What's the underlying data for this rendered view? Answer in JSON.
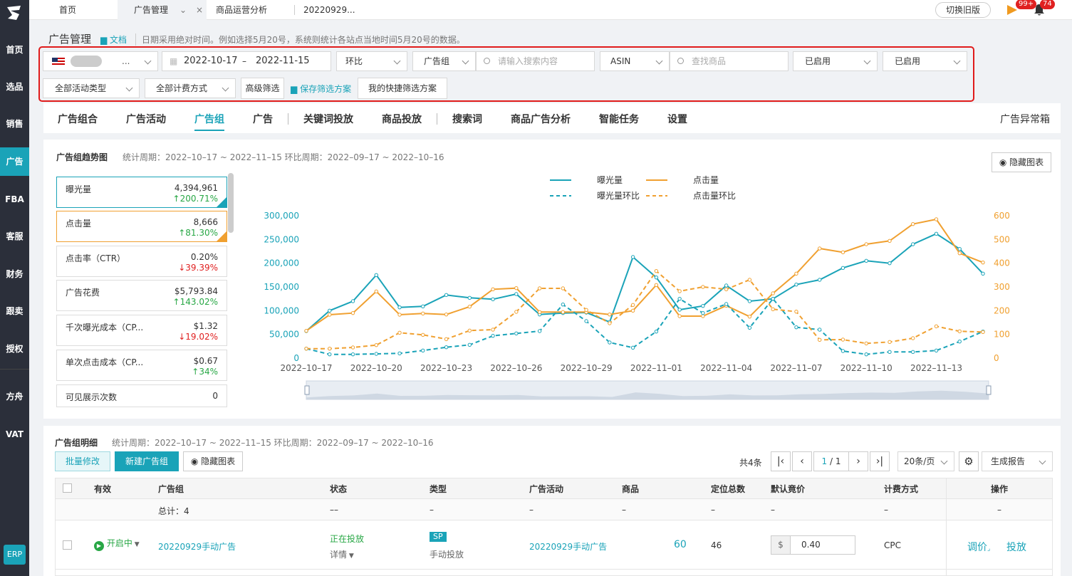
{
  "sidebar": {
    "items": [
      {
        "label": "首页",
        "active": false
      },
      {
        "label": "选品",
        "active": false
      },
      {
        "label": "销售",
        "active": false
      },
      {
        "label": "广告",
        "active": true
      },
      {
        "label": "FBA",
        "active": false
      },
      {
        "label": "客服",
        "active": false
      },
      {
        "label": "财务",
        "active": false
      },
      {
        "label": "跟卖",
        "active": false
      },
      {
        "label": "授权",
        "active": false
      },
      {
        "label": "方舟",
        "active": false
      },
      {
        "label": "VAT",
        "active": false
      }
    ],
    "erp": "ERP"
  },
  "topbar": {
    "tabs": [
      {
        "label": "首页"
      },
      {
        "label": "广告管理",
        "active": true
      },
      {
        "label": "商品运营分析"
      },
      {
        "label": "20220929..."
      }
    ],
    "tab_close": "×",
    "switch_old": "切换旧版",
    "badge1": "99+",
    "badge2": "74"
  },
  "header": {
    "title": "广告管理",
    "doc": "文档",
    "tip": "日期采用绝对时间。例如选择5月20号，系统则统计各站点当地时间5月20号的数据。"
  },
  "filters": {
    "store_suffix": "...",
    "date_from": "2022-10-17",
    "date_sep": "–",
    "date_to": "2022-11-15",
    "compare": "环比",
    "group": "广告组",
    "search_placeholder": "请输入搜索内容",
    "asin": "ASIN",
    "product_placeholder": "查找商品",
    "status1": "已启用",
    "status2": "已启用",
    "activity_type": "全部活动类型",
    "billing": "全部计费方式",
    "advanced": "高级筛选",
    "save_scheme": "保存筛选方案",
    "my_scheme": "我的快捷筛选方案"
  },
  "nav": {
    "tabs": [
      "广告组合",
      "广告活动",
      "广告组",
      "广告",
      "关键词投放",
      "商品投放",
      "搜索词",
      "商品广告分析",
      "智能任务",
      "设置"
    ],
    "right": "广告异常箱"
  },
  "trend": {
    "title": "广告组趋势图",
    "period": "统计周期：2022–10–17 ~ 2022–11–15 环比周期：2022–09–17 ~ 2022–10–16",
    "hide": "隐藏图表",
    "metrics": [
      {
        "name": "曝光量",
        "value": "4,394,961",
        "change": "↑200.71%",
        "dir": "up"
      },
      {
        "name": "点击量",
        "value": "8,666",
        "change": "↑81.30%",
        "dir": "up"
      },
      {
        "name": "点击率（CTR）",
        "value": "0.20%",
        "change": "↓39.39%",
        "dir": "down"
      },
      {
        "name": "广告花费",
        "value": "$5,793.84",
        "change": "↑143.02%",
        "dir": "up"
      },
      {
        "name": "千次曝光成本（CP...",
        "value": "$1.32",
        "change": "↓19.02%",
        "dir": "down"
      },
      {
        "name": "单次点击成本（CP...",
        "value": "$0.67",
        "change": "↑34%",
        "dir": "up"
      },
      {
        "name": "可见展示次数",
        "value": "0",
        "change": "–",
        "dir": "none"
      }
    ]
  },
  "chart_data": {
    "type": "line",
    "x": [
      "2022-10-17",
      "2022-10-18",
      "2022-10-19",
      "2022-10-20",
      "2022-10-21",
      "2022-10-22",
      "2022-10-23",
      "2022-10-24",
      "2022-10-25",
      "2022-10-26",
      "2022-10-27",
      "2022-10-28",
      "2022-10-29",
      "2022-10-30",
      "2022-10-31",
      "2022-11-01",
      "2022-11-02",
      "2022-11-03",
      "2022-11-04",
      "2022-11-05",
      "2022-11-06",
      "2022-11-07",
      "2022-11-08",
      "2022-11-09",
      "2022-11-10",
      "2022-11-11",
      "2022-11-12",
      "2022-11-13",
      "2022-11-14",
      "2022-11-15"
    ],
    "tick_labels": [
      "2022–10–17",
      "2022–10–20",
      "2022–10–23",
      "2022–10–26",
      "2022–10–29",
      "2022–11–01",
      "2022–11–04",
      "2022–11–07",
      "2022–11–10",
      "2022–11–13"
    ],
    "tick_every": 3,
    "yleft": {
      "ticks": [
        "0",
        "50,000",
        "100,000",
        "150,000",
        "200,000",
        "250,000",
        "300,000"
      ],
      "max": 300000
    },
    "yright": {
      "ticks": [
        "0",
        "100",
        "200",
        "300",
        "400",
        "500",
        "600"
      ],
      "max": 600
    },
    "series": [
      {
        "name": "曝光量",
        "axis": "left",
        "dash": false,
        "color": "#1aa3b8",
        "values": [
          57000,
          100000,
          120000,
          175000,
          107000,
          109000,
          133000,
          127000,
          124000,
          135000,
          92000,
          95000,
          96000,
          76000,
          213000,
          170000,
          102000,
          110000,
          153000,
          120000,
          125000,
          155000,
          165000,
          190000,
          205000,
          200000,
          240000,
          262000,
          230000,
          178000
        ]
      },
      {
        "name": "点击量",
        "axis": "right",
        "dash": false,
        "color": "#f0a030",
        "values": [
          115,
          183,
          190,
          281,
          183,
          188,
          184,
          217,
          290,
          295,
          194,
          194,
          194,
          184,
          200,
          308,
          177,
          177,
          221,
          175,
          273,
          356,
          462,
          446,
          480,
          494,
          565,
          585,
          442,
          403
        ]
      },
      {
        "name": "曝光量环比",
        "axis": "left",
        "dash": true,
        "color": "#1aa3b8",
        "values": [
          20000,
          8000,
          8000,
          9000,
          10000,
          16000,
          23000,
          28000,
          47000,
          52000,
          57000,
          113000,
          78000,
          33000,
          22000,
          56000,
          125000,
          95000,
          114000,
          64000,
          125000,
          65000,
          60000,
          15000,
          8000,
          13000,
          13000,
          16000,
          35000,
          56000
        ]
      },
      {
        "name": "点击量环比",
        "axis": "right",
        "dash": true,
        "color": "#f0a030",
        "values": [
          40,
          40,
          45,
          55,
          107,
          98,
          80,
          116,
          120,
          195,
          294,
          294,
          203,
          147,
          224,
          367,
          282,
          300,
          290,
          330,
          206,
          196,
          77,
          78,
          62,
          68,
          84,
          134,
          113,
          110
        ]
      }
    ]
  },
  "detail": {
    "title": "广告组明细",
    "period": "统计周期：2022–10–17 ~ 2022–11–15 环比周期：2022–09–17 ~ 2022–10–16",
    "batch": "批量修改",
    "create": "新建广告组",
    "hide": "隐藏图表",
    "total": "共4条",
    "page_cur": "1",
    "page_total": "/ 1",
    "page_size": "20条/页",
    "report": "生成报告",
    "columns": [
      "有效",
      "广告组",
      "状态",
      "类型",
      "广告活动",
      "商品",
      "定位总数",
      "默认竟价",
      "计费方式",
      "操作"
    ],
    "summary": {
      "label": "总计：4",
      "dash1": "––",
      "dash": "–"
    },
    "row": {
      "valid": "开启中",
      "group": "20220929手动广告",
      "status": "正在投放",
      "detail": "详情",
      "type_badge": "SP",
      "type": "手动投放",
      "campaign": "20220929手动广告",
      "product": "60",
      "targets": "46",
      "currency": "$",
      "bid": "0.40",
      "billing": "CPC",
      "adjust": "调价",
      "deliver": "投放"
    }
  }
}
